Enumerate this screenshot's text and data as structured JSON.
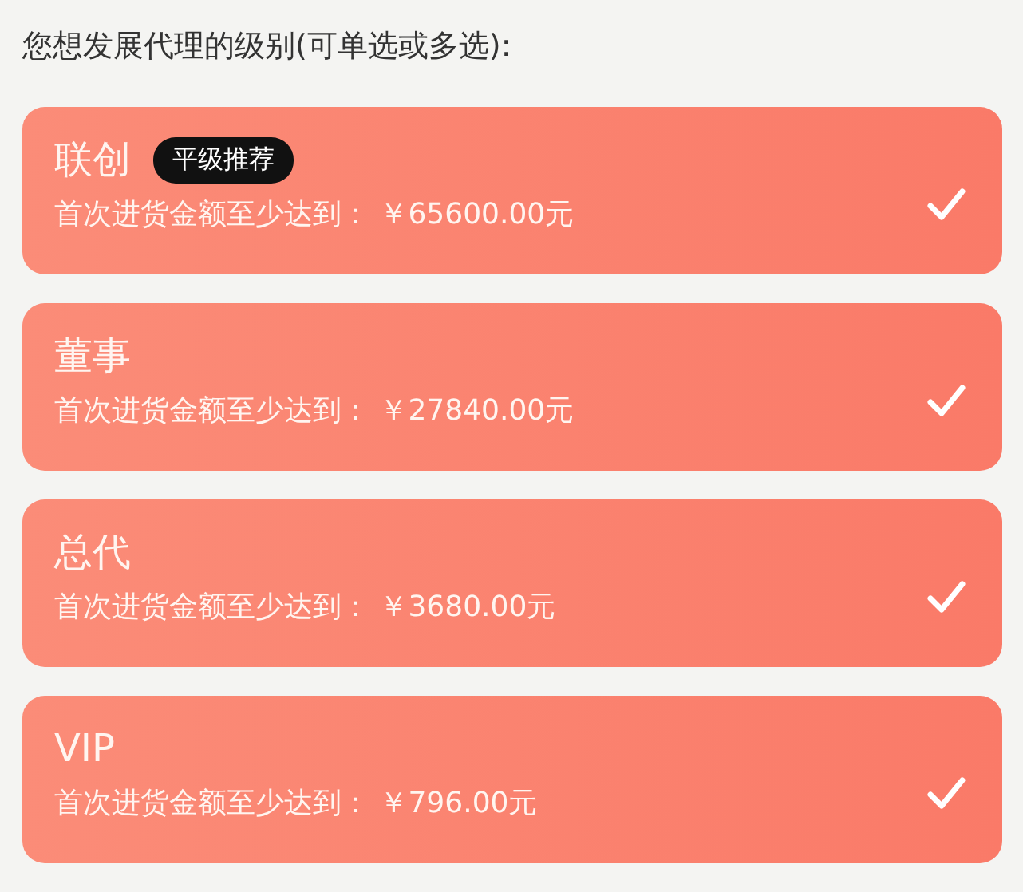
{
  "prompt": "您想发展代理的级别(可单选或多选):",
  "options": [
    {
      "name": "联创",
      "badge": "平级推荐",
      "requirement": "首次进货金额至少达到：",
      "amount": "￥65600.00元",
      "selected": true
    },
    {
      "name": "董事",
      "requirement": "首次进货金额至少达到：",
      "amount": "￥27840.00元",
      "selected": true
    },
    {
      "name": "总代",
      "requirement": "首次进货金额至少达到：",
      "amount": "￥3680.00元",
      "selected": true
    },
    {
      "name": "VIP",
      "requirement": "首次进货金额至少达到：",
      "amount": "￥796.00元",
      "selected": true
    }
  ]
}
